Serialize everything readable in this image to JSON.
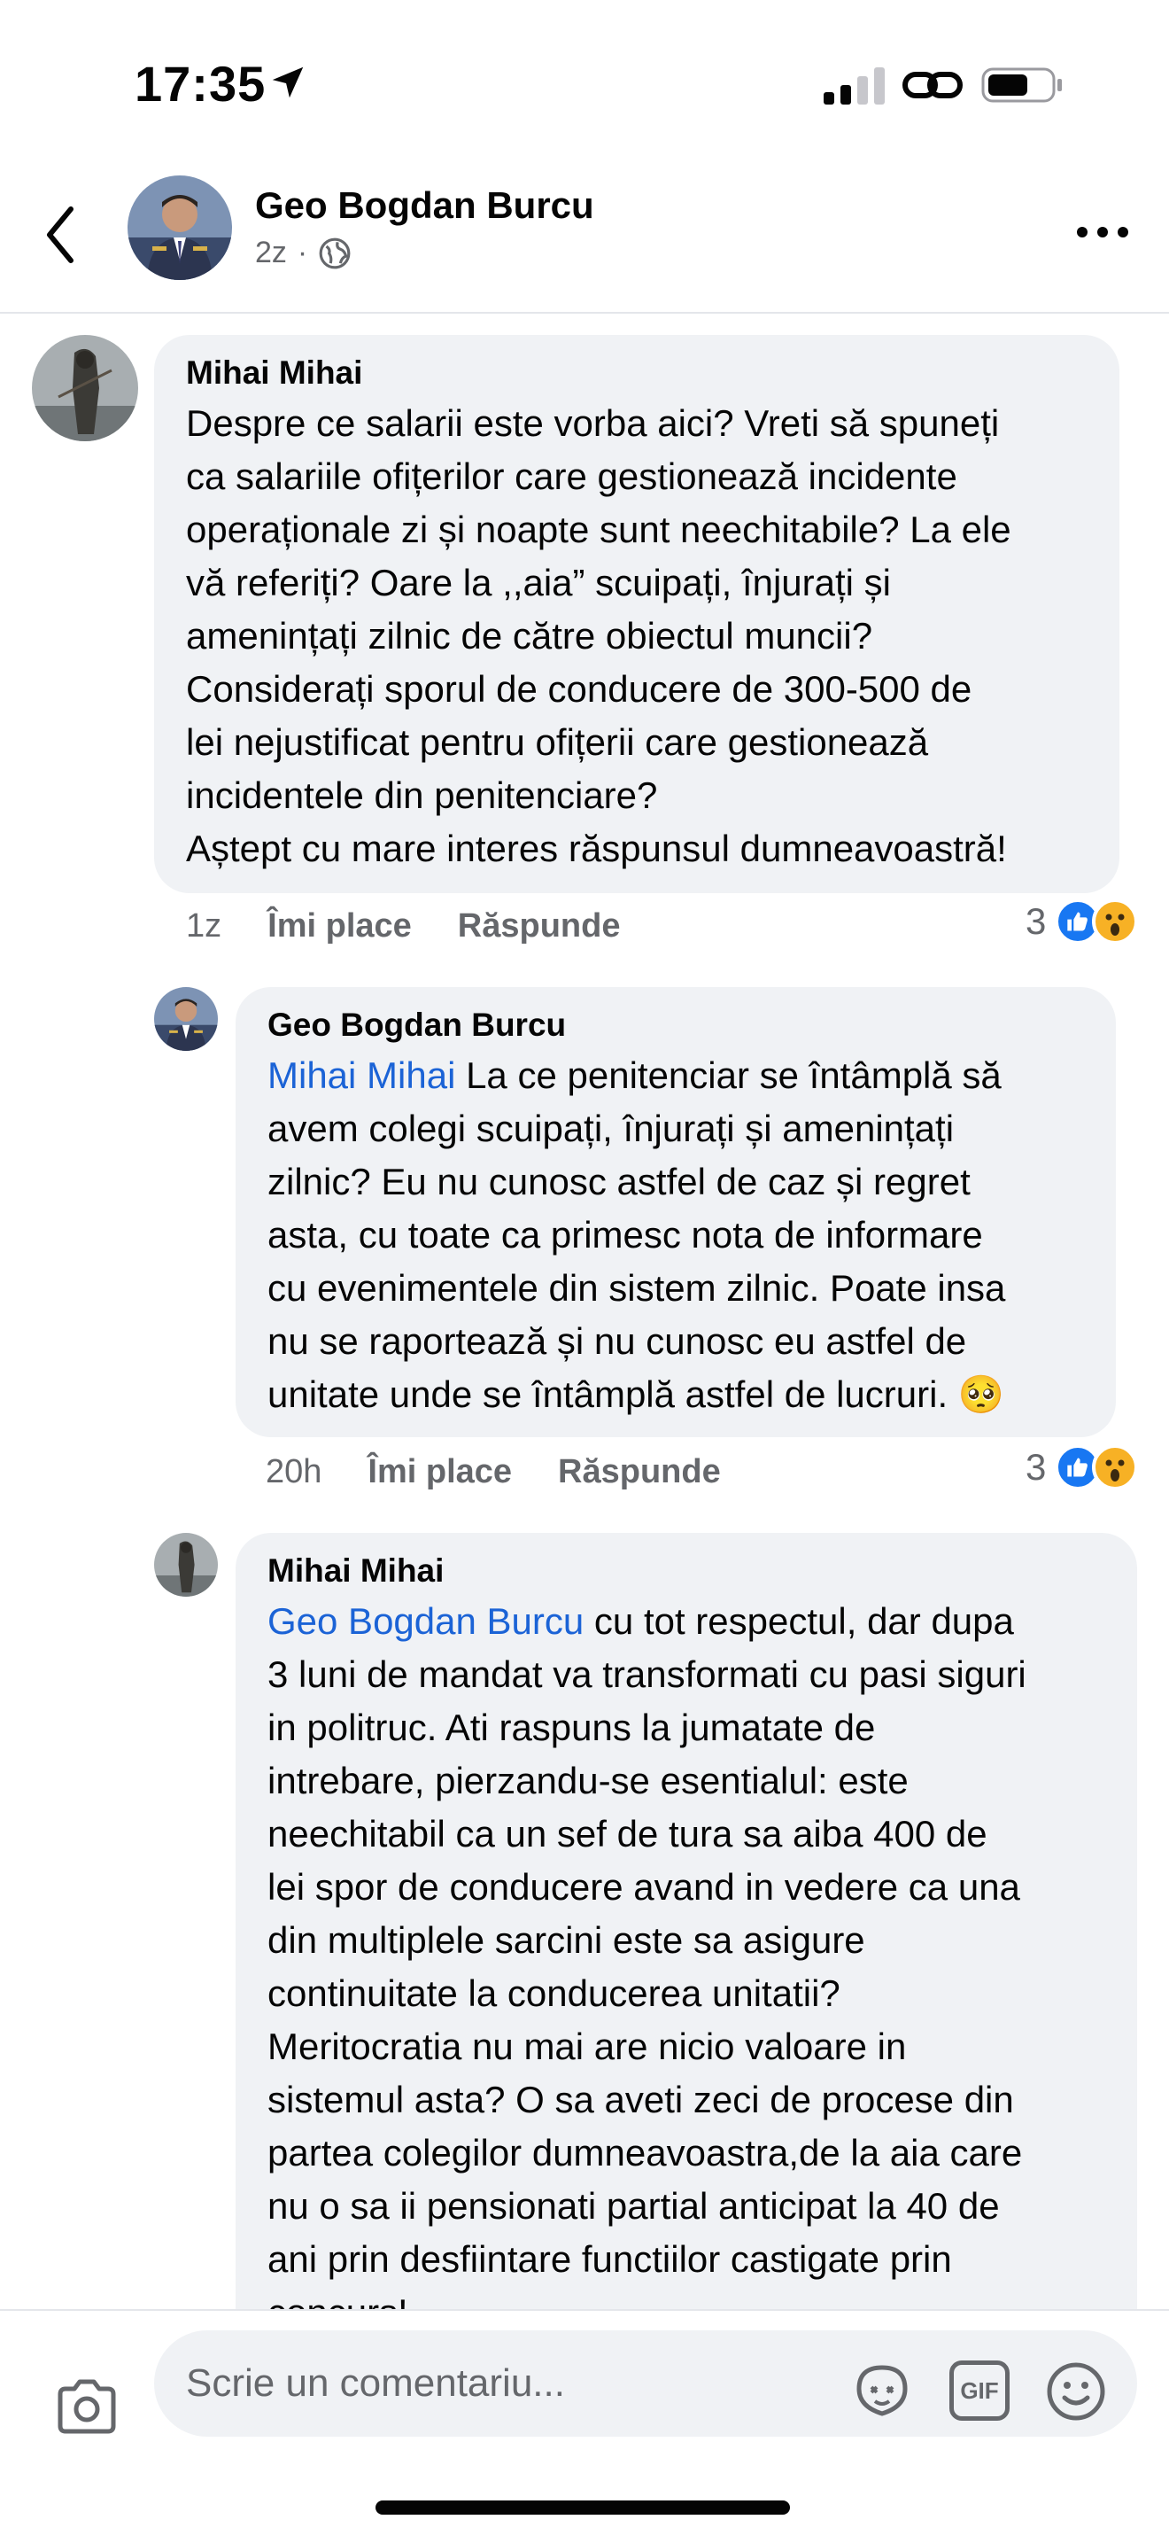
{
  "status_bar": {
    "time": "17:35"
  },
  "header": {
    "name": "Geo Bogdan Burcu",
    "time_ago": "2z",
    "separator": "·",
    "visibility_icon": "globe-icon"
  },
  "comments": [
    {
      "author": "Mihai Mihai",
      "text": "Despre ce salarii este vorba aici? Vreti să spuneți\nca salariile ofițerilor care gestionează incidente\noperaționale zi și noapte sunt neechitabile? La ele\nvă referiți? Oare la ,,aia” scuipați, înjurați și\namenințați zilnic de către obiectul muncii?\nConsiderați sporul de conducere de 300-500 de\nlei  nejustificat pentru ofițerii care gestionează\nincidentele din penitenciare?\nAștept cu mare interes răspunsul dumneavoastră!",
      "time_ago": "1z",
      "like_label": "Îmi place",
      "reply_label": "Răspunde",
      "reaction_count": "3"
    },
    {
      "author": "Geo Bogdan Burcu",
      "mention": "Mihai Mihai",
      "text": " La ce penitenciar se întâmplă să\navem colegi scuipați, înjurați și amenințați\nzilnic? Eu nu cunosc astfel de caz și regret\nasta, cu toate ca primesc nota de informare\ncu evenimentele din sistem zilnic. Poate insa\nnu se raportează și nu cunosc eu astfel de\nunitate unde se întâmplă astfel de lucruri. 🥺",
      "time_ago": "20h",
      "like_label": "Îmi place",
      "reply_label": "Răspunde",
      "reaction_count": "3"
    },
    {
      "author": "Mihai Mihai",
      "mention": "Geo Bogdan Burcu",
      "text": " cu tot respectul, dar dupa\n3 luni de mandat va transformati cu pasi siguri\nin politruc.  Ati raspuns la jumatate de\nintrebare, pierzandu-se esentialul: este\nneechitabil ca un sef de tura sa aiba 400 de\nlei spor de conducere avand in vedere ca una\ndin multiplele  sarcini este sa asigure\ncontinuitate la conducerea unitatii?\nMeritocratia nu mai are nicio valoare in\nsistemul asta? O sa aveti zeci de procese din\npartea colegilor dumneavoastra,de la aia care\nnu o sa ii pensionati partial anticipat la 40 de\nani prin desfiintare functiilor castigate prin\nconcurs!"
    }
  ],
  "composer": {
    "placeholder": "Scrie un comentariu...",
    "gif_label": "GIF"
  },
  "colors": {
    "mention": "#1b63d6",
    "bubble": "#f0f2f5",
    "like": "#1877f2",
    "wow": "#f7b125",
    "secondary_text": "#65676b"
  }
}
